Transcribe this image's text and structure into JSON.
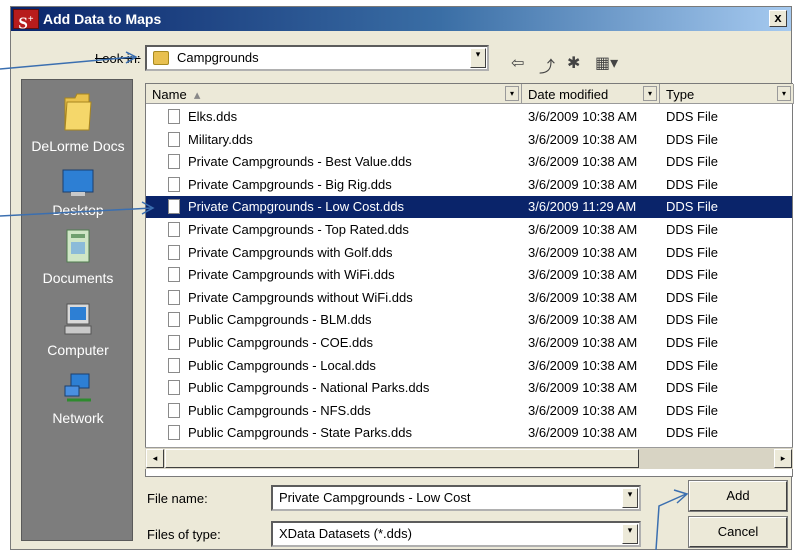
{
  "window": {
    "app_icon_text": "S",
    "app_icon_sup": "+",
    "title": "Add Data to Maps",
    "close_label": "x"
  },
  "look_in": {
    "label": "Look in:",
    "value": "Campgrounds"
  },
  "toolbar": {
    "back_glyph": "⇦",
    "up_glyph": "⤴",
    "newfolder_glyph": "✱",
    "views_glyph": "▦▾"
  },
  "places": [
    {
      "label": "DeLorme Docs",
      "icon": "folder-icon"
    },
    {
      "label": "Desktop",
      "icon": "desktop-icon"
    },
    {
      "label": "Documents",
      "icon": "documents-icon"
    },
    {
      "label": "Computer",
      "icon": "computer-icon"
    },
    {
      "label": "Network",
      "icon": "network-icon"
    }
  ],
  "columns": {
    "name": "Name",
    "sort_glyph": "▴",
    "date": "Date modified",
    "type": "Type"
  },
  "files": [
    {
      "name": "Elks.dds",
      "date": "3/6/2009 10:38 AM",
      "type": "DDS File"
    },
    {
      "name": "Military.dds",
      "date": "3/6/2009 10:38 AM",
      "type": "DDS File"
    },
    {
      "name": "Private Campgrounds - Best Value.dds",
      "date": "3/6/2009 10:38 AM",
      "type": "DDS File"
    },
    {
      "name": "Private Campgrounds - Big Rig.dds",
      "date": "3/6/2009 10:38 AM",
      "type": "DDS File"
    },
    {
      "name": "Private Campgrounds - Low Cost.dds",
      "date": "3/6/2009 11:29 AM",
      "type": "DDS File",
      "selected": true
    },
    {
      "name": "Private Campgrounds - Top Rated.dds",
      "date": "3/6/2009 10:38 AM",
      "type": "DDS File"
    },
    {
      "name": "Private Campgrounds with Golf.dds",
      "date": "3/6/2009 10:38 AM",
      "type": "DDS File"
    },
    {
      "name": "Private Campgrounds with WiFi.dds",
      "date": "3/6/2009 10:38 AM",
      "type": "DDS File"
    },
    {
      "name": "Private Campgrounds without WiFi.dds",
      "date": "3/6/2009 10:38 AM",
      "type": "DDS File"
    },
    {
      "name": "Public Campgrounds - BLM.dds",
      "date": "3/6/2009 10:38 AM",
      "type": "DDS File"
    },
    {
      "name": "Public Campgrounds - COE.dds",
      "date": "3/6/2009 10:38 AM",
      "type": "DDS File"
    },
    {
      "name": "Public Campgrounds - Local.dds",
      "date": "3/6/2009 10:38 AM",
      "type": "DDS File"
    },
    {
      "name": "Public Campgrounds - National Parks.dds",
      "date": "3/6/2009 10:38 AM",
      "type": "DDS File"
    },
    {
      "name": "Public Campgrounds - NFS.dds",
      "date": "3/6/2009 10:38 AM",
      "type": "DDS File"
    },
    {
      "name": "Public Campgrounds - State Parks.dds",
      "date": "3/6/2009 10:38 AM",
      "type": "DDS File"
    }
  ],
  "scroll": {
    "left_glyph": "◂",
    "right_glyph": "▸"
  },
  "form": {
    "filename_label": "File name:",
    "filename_value": "Private Campgrounds - Low Cost",
    "filetype_label": "Files of type:",
    "filetype_value": "XData Datasets (*.dds)",
    "dropdown_glyph": "▾"
  },
  "buttons": {
    "add": "Add",
    "cancel": "Cancel"
  },
  "colors": {
    "selection": "#0a246a",
    "callout": "#3b6fb0",
    "places_bg": "#7d7d7d"
  }
}
